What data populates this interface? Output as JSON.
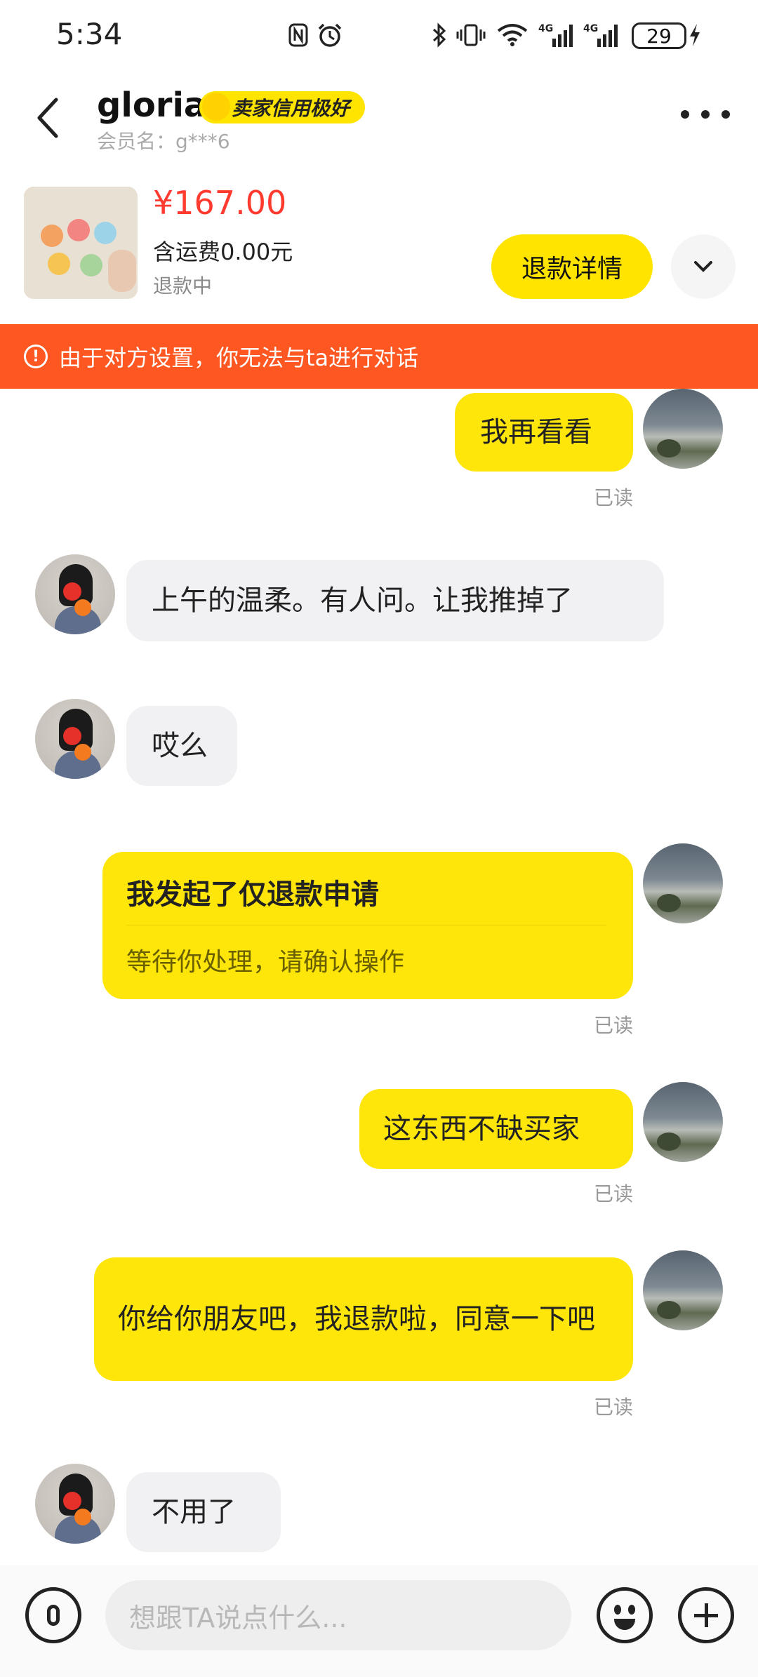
{
  "status_bar": {
    "time": "5:34",
    "battery": "29",
    "icons": [
      "nfc-icon",
      "alarm-icon",
      "bluetooth-icon",
      "vibrate-icon",
      "wifi-icon",
      "signal-4g-icon",
      "signal-4g-icon",
      "charging-icon"
    ]
  },
  "header": {
    "name": "gloria",
    "badge": "卖家信用极好",
    "member": "会员名：g***6"
  },
  "product": {
    "price": "¥167.00",
    "shipping": "含运费0.00元",
    "status": "退款中",
    "refund_button": "退款详情"
  },
  "warning": {
    "text": "由于对方设置，你无法与ta进行对话"
  },
  "messages": [
    {
      "from": "me",
      "text": "我再看看",
      "read": "已读"
    },
    {
      "from": "other",
      "text": "上午的温柔。有人问。让我推掉了"
    },
    {
      "from": "other",
      "text": "哎么"
    },
    {
      "from": "me",
      "type": "card",
      "title": "我发起了仅退款申请",
      "subtitle": "等待你处理，请确认操作",
      "read": "已读"
    },
    {
      "from": "me",
      "text": "这东西不缺买家",
      "read": "已读"
    },
    {
      "from": "me",
      "text": "你给你朋友吧，我退款啦，同意一下吧",
      "read": "已读"
    },
    {
      "from": "other",
      "text": "不用了"
    }
  ],
  "input": {
    "placeholder": "想跟TA说点什么..."
  },
  "colors": {
    "accent": "#ffe60a",
    "warning_bg": "#ff5722",
    "price": "#ff3b30"
  }
}
